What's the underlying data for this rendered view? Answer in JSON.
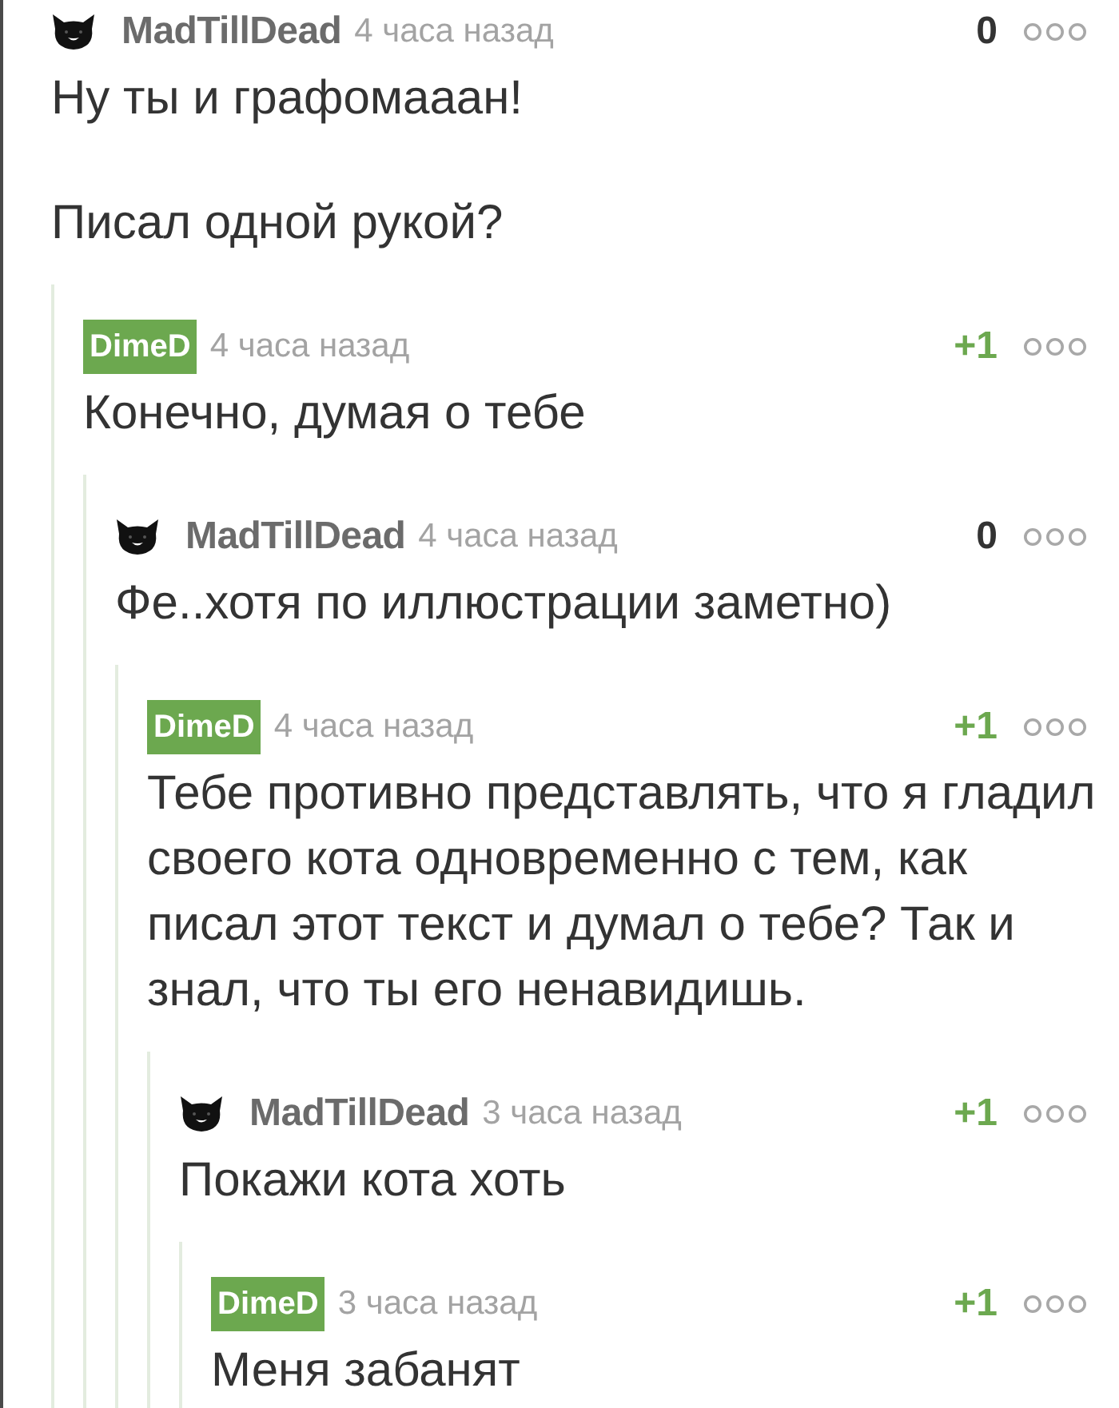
{
  "comments": [
    {
      "author": "MadTillDead",
      "author_highlighted": false,
      "time": "4 часа назад",
      "rating": "0",
      "rating_positive": false,
      "paragraphs": [
        "Ну ты и графомааан!",
        "Писал одной рукой?"
      ],
      "children": [
        {
          "author": "DimeD",
          "author_highlighted": true,
          "time": "4 часа назад",
          "rating": "+1",
          "rating_positive": true,
          "paragraphs": [
            "Конечно, думая о тебе"
          ],
          "children": [
            {
              "author": "MadTillDead",
              "author_highlighted": false,
              "time": "4 часа назад",
              "rating": "0",
              "rating_positive": false,
              "paragraphs": [
                "Фе..хотя по иллюстрации заметно)"
              ],
              "children": [
                {
                  "author": "DimeD",
                  "author_highlighted": true,
                  "time": "4 часа назад",
                  "rating": "+1",
                  "rating_positive": true,
                  "paragraphs": [
                    "Тебе противно представлять, что я гладил своего кота одновременно с тем, как писал этот текст и думал о тебе? Так и знал, что ты его ненавидишь."
                  ],
                  "children": [
                    {
                      "author": "MadTillDead",
                      "author_highlighted": false,
                      "time": "3 часа назад",
                      "rating": "+1",
                      "rating_positive": true,
                      "paragraphs": [
                        "Покажи кота хоть"
                      ],
                      "children": [
                        {
                          "author": "DimeD",
                          "author_highlighted": true,
                          "time": "3 часа назад",
                          "rating": "+1",
                          "rating_positive": true,
                          "paragraphs": [
                            "Меня забанят"
                          ]
                        }
                      ]
                    }
                  ]
                }
              ]
            }
          ]
        }
      ]
    }
  ]
}
